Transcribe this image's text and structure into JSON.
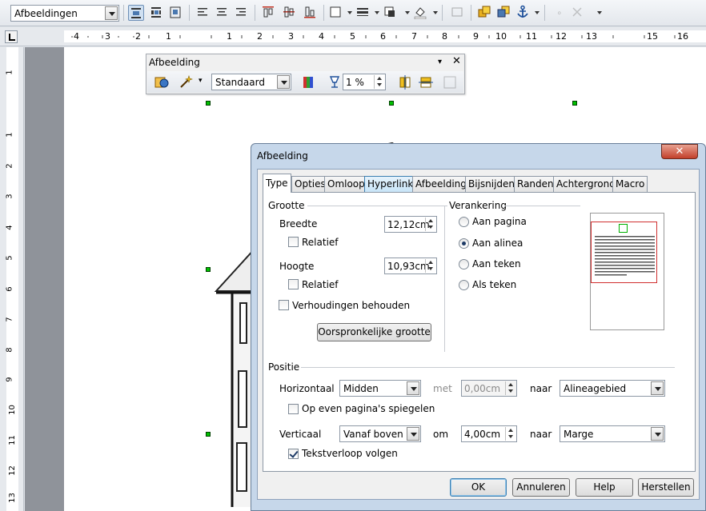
{
  "toolbar": {
    "style_combo": "Afbeeldingen",
    "icons": [
      "wrap-off-icon",
      "wrap-page-icon",
      "wrap-optimal-icon",
      "align-left-icon",
      "align-center-icon",
      "align-right-icon",
      "align-top-icon",
      "align-middle-icon",
      "align-bottom-icon",
      "borders-icon",
      "line-style-icon",
      "border-color-icon",
      "background-color-icon",
      "caption-icon",
      "bring-forward-icon",
      "send-backward-icon",
      "anchor-icon",
      "link-frames-icon",
      "unlink-frames-icon"
    ]
  },
  "hruler": {
    "numbers": [
      "4",
      "3",
      "2",
      "1",
      "1",
      "2",
      "3",
      "4",
      "5",
      "6",
      "7",
      "8",
      "9",
      "10",
      "11",
      "12",
      "13",
      "15",
      "16"
    ]
  },
  "vruler": {
    "numbers": [
      "1",
      "1",
      "2",
      "3",
      "4",
      "5",
      "6",
      "7",
      "8",
      "9",
      "10",
      "11",
      "12",
      "13"
    ]
  },
  "picture_toolbar": {
    "title": "Afbeelding",
    "mode_combo": "Standaard",
    "transparency_value": "1 %"
  },
  "dialog": {
    "title": "Afbeelding",
    "close_label": "✕",
    "tabs": [
      "Type",
      "Opties",
      "Omloop",
      "Hyperlink",
      "Afbeelding",
      "Bijsnijden",
      "Randen",
      "Achtergrond",
      "Macro"
    ],
    "size": {
      "heading": "Grootte",
      "width_label": "Breedte",
      "width_value": "12,12cm",
      "relative_width_label": "Relatief",
      "height_label": "Hoogte",
      "height_value": "10,93cm",
      "relative_height_label": "Relatief",
      "keep_ratio_label": "Verhoudingen behouden",
      "original_size_button": "Oorspronkelijke grootte"
    },
    "anchor": {
      "heading": "Verankering",
      "options": [
        "Aan pagina",
        "Aan alinea",
        "Aan teken",
        "Als teken"
      ],
      "selected": "Aan alinea"
    },
    "position": {
      "heading": "Positie",
      "horizontal_label": "Horizontaal",
      "horizontal_value": "Midden",
      "by_label": "met",
      "by_value": "0,00cm",
      "to_label": "naar",
      "horizontal_to_value": "Alineagebied",
      "mirror_label": "Op even pagina's spiegelen",
      "vertical_label": "Verticaal",
      "vertical_value": "Vanaf boven",
      "by2_label": "om",
      "by2_value": "4,00cm",
      "to2_label": "naar",
      "vertical_to_value": "Marge",
      "follow_text_label": "Tekstverloop volgen"
    },
    "buttons": {
      "ok": "OK",
      "cancel": "Annuleren",
      "help": "Help",
      "reset": "Herstellen"
    }
  }
}
